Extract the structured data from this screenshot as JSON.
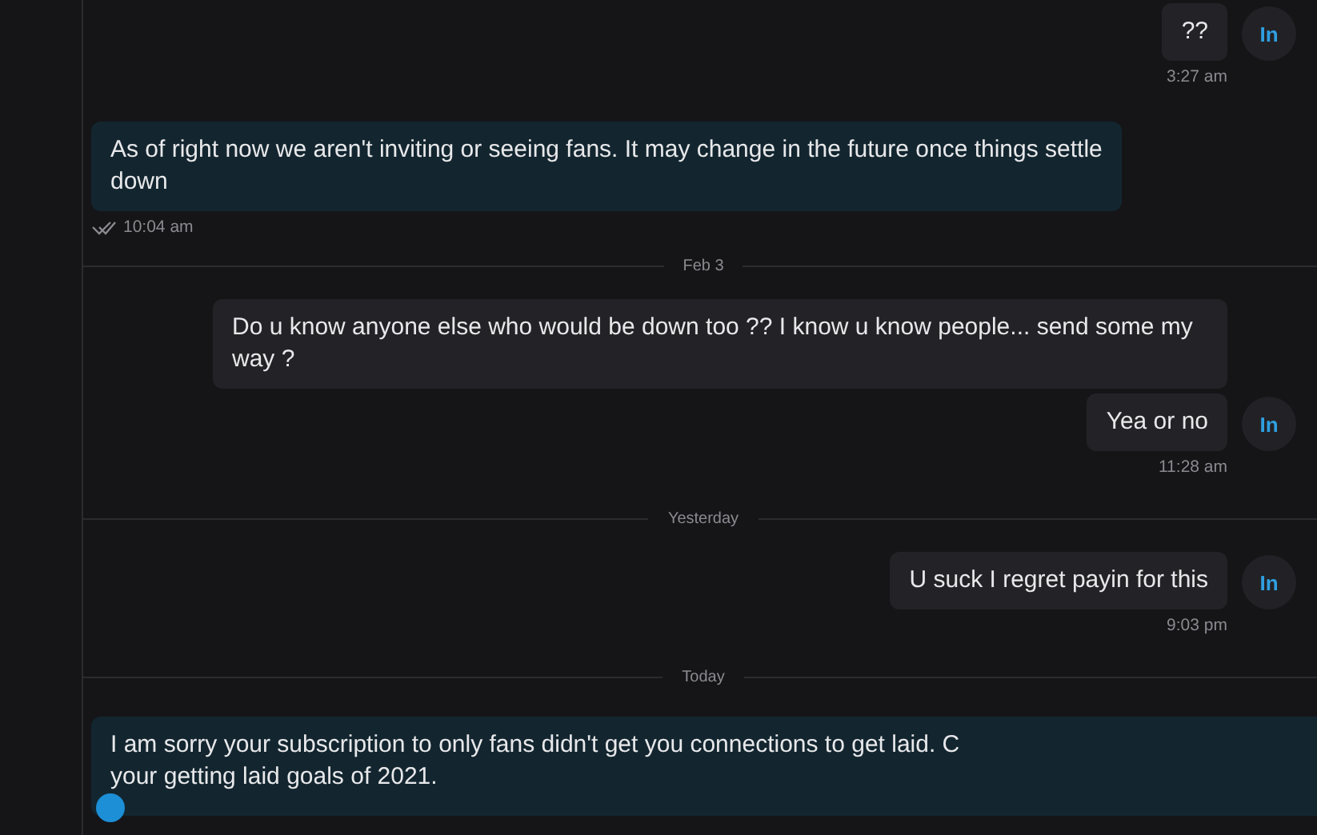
{
  "messages": [
    {
      "kind": "incoming",
      "text": "??",
      "avatar": "In",
      "time": "3:27 am"
    },
    {
      "kind": "outgoing",
      "text": "As of right now we aren't inviting or seeing fans. It may change in the future once things settle down",
      "time": "10:04 am",
      "read": true
    },
    {
      "kind": "divider",
      "label": "Feb 3"
    },
    {
      "kind": "incoming",
      "text": "Do u know anyone else who would be down too ?? I know u know people... send some my way ?"
    },
    {
      "kind": "incoming",
      "text": "Yea or no",
      "avatar": "In",
      "time": "11:28 am"
    },
    {
      "kind": "divider",
      "label": "Yesterday"
    },
    {
      "kind": "incoming",
      "text": "U suck I regret payin for this",
      "avatar": "In",
      "time": "9:03 pm"
    },
    {
      "kind": "divider",
      "label": "Today"
    },
    {
      "kind": "outgoing",
      "text": "I am sorry your subscription to only fans didn't get you connections to get laid. C\nyour getting laid goals of 2021.",
      "sender_badge": true
    }
  ]
}
